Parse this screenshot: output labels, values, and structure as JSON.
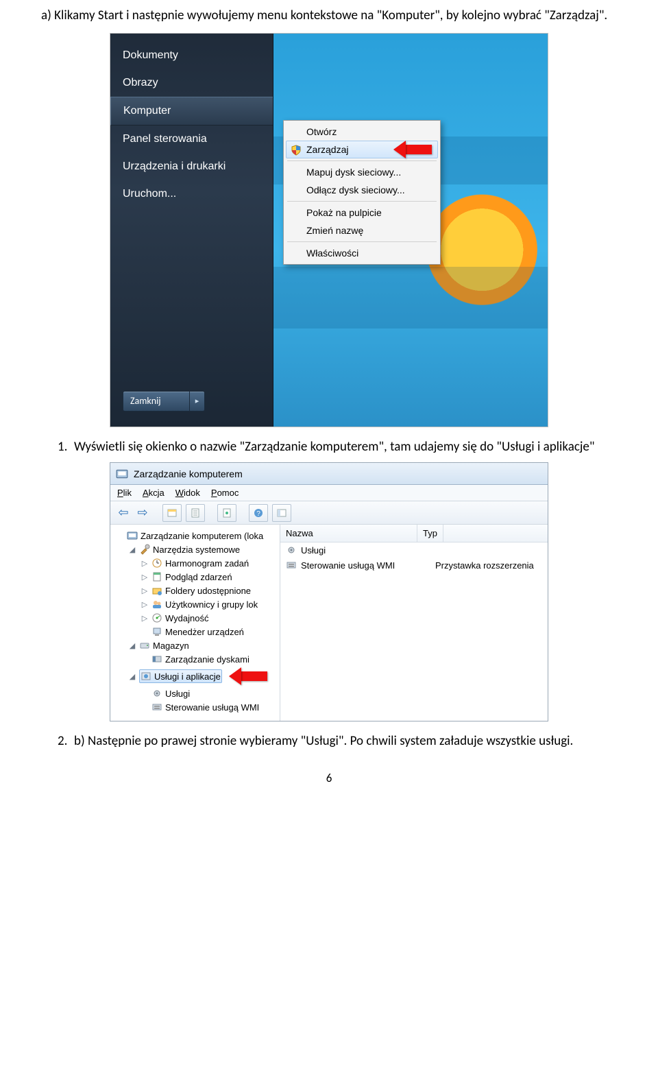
{
  "text": {
    "intro": "a) Klikamy Start i następnie wywołujemy menu kontekstowe na \"Komputer\", by kolejno wybrać \"Zarządzaj\".",
    "step1_num": "1.",
    "step1": "Wyświetli się okienko o nazwie \"Zarządzanie komputerem\", tam udajemy się do \"Usługi i aplikacje\"",
    "step2_num": "2.",
    "step2": "b) Następnie po prawej stronie wybieramy \"Usługi\". Po chwili system załaduje wszystkie usługi.",
    "pagenum": "6"
  },
  "shot1": {
    "start_items": [
      "Dokumenty",
      "Obrazy",
      "Komputer",
      "Panel sterowania",
      "Urządzenia i drukarki",
      "Uruchom..."
    ],
    "start_highlight_index": 2,
    "shutdown": "Zamknij",
    "ctx": {
      "groups": [
        [
          "Otwórz",
          "Zarządzaj"
        ],
        [
          "Mapuj dysk sieciowy...",
          "Odłącz dysk sieciowy..."
        ],
        [
          "Pokaż na pulpicie",
          "Zmień nazwę"
        ],
        [
          "Właściwości"
        ]
      ],
      "highlight": "Zarządzaj"
    }
  },
  "shot2": {
    "title": "Zarządzanie komputerem",
    "menus": [
      "Plik",
      "Akcja",
      "Widok",
      "Pomoc"
    ],
    "tree": [
      {
        "d": 0,
        "tw": "",
        "icon": "mgmt",
        "label": "Zarządzanie komputerem (loka"
      },
      {
        "d": 1,
        "tw": "◢",
        "icon": "tools",
        "label": "Narzędzia systemowe"
      },
      {
        "d": 2,
        "tw": "▷",
        "icon": "clock",
        "label": "Harmonogram zadań"
      },
      {
        "d": 2,
        "tw": "▷",
        "icon": "event",
        "label": "Podgląd zdarzeń"
      },
      {
        "d": 2,
        "tw": "▷",
        "icon": "share",
        "label": "Foldery udostępnione"
      },
      {
        "d": 2,
        "tw": "▷",
        "icon": "users",
        "label": "Użytkownicy i grupy lok"
      },
      {
        "d": 2,
        "tw": "▷",
        "icon": "perf",
        "label": "Wydajność"
      },
      {
        "d": 2,
        "tw": "",
        "icon": "devmgr",
        "label": "Menedżer urządzeń"
      },
      {
        "d": 1,
        "tw": "◢",
        "icon": "storage",
        "label": "Magazyn"
      },
      {
        "d": 2,
        "tw": "",
        "icon": "disk",
        "label": "Zarządzanie dyskami"
      },
      {
        "d": 1,
        "tw": "◢",
        "icon": "svc",
        "label": "Usługi i aplikacje",
        "sel": true,
        "arrow": true
      },
      {
        "d": 2,
        "tw": "",
        "icon": "gear",
        "label": "Usługi"
      },
      {
        "d": 2,
        "tw": "",
        "icon": "wmi",
        "label": "Sterowanie usługą WMI"
      }
    ],
    "columns": [
      "Nazwa",
      "Typ"
    ],
    "rows": [
      {
        "icon": "gear",
        "name": "Usługi",
        "type": ""
      },
      {
        "icon": "wmi",
        "name": "Sterowanie usługą WMI",
        "type": "Przystawka rozszerzenia"
      }
    ]
  }
}
